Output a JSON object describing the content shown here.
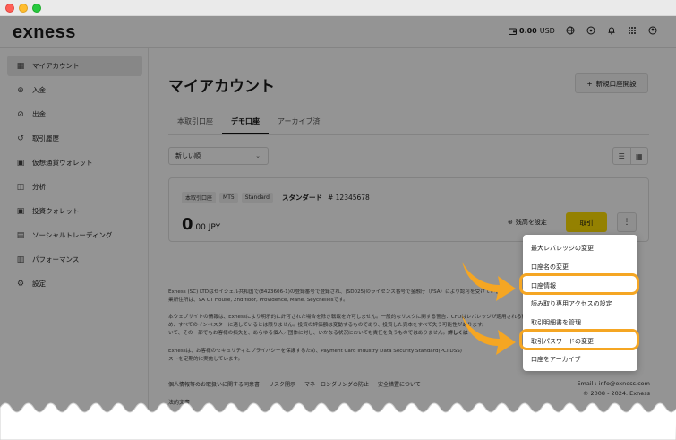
{
  "header": {
    "logo": "exness",
    "balance_amount": "0.00",
    "balance_currency": "USD",
    "icons": [
      "wallet-icon",
      "globe-icon",
      "help-icon",
      "bell-icon",
      "apps-grid-icon",
      "profile-icon"
    ]
  },
  "sidebar": {
    "items": [
      {
        "label": "マイアカウント",
        "icon": "grid-icon"
      },
      {
        "label": "入金",
        "icon": "deposit-icon"
      },
      {
        "label": "出金",
        "icon": "withdraw-icon"
      },
      {
        "label": "取引履歴",
        "icon": "history-icon"
      },
      {
        "label": "仮想通貨ウォレット",
        "icon": "wallet-icon"
      },
      {
        "label": "分析",
        "icon": "analytics-icon"
      },
      {
        "label": "投資ウォレット",
        "icon": "invest-wallet-icon"
      },
      {
        "label": "ソーシャルトレーディング",
        "icon": "social-icon"
      },
      {
        "label": "パフォーマンス",
        "icon": "performance-icon"
      },
      {
        "label": "設定",
        "icon": "settings-icon"
      }
    ]
  },
  "main": {
    "title": "マイアカウント",
    "new_account_label": "新規口座開設",
    "tabs": [
      {
        "label": "本取引口座"
      },
      {
        "label": "デモ口座"
      },
      {
        "label": "アーカイブ済"
      }
    ],
    "sort_select": "新しい順",
    "account": {
      "badges": [
        "本取引口座",
        "MT5",
        "Standard"
      ],
      "name": "スタンダード",
      "number": "# 12345678",
      "balance_int": "0",
      "balance_dec": ".00 JPY",
      "set_balance_label": "残高を設定",
      "trade_label": "取引"
    }
  },
  "dropdown": {
    "items": [
      "最大レバレッジの変更",
      "口座名の変更",
      "口座情報",
      "読み取り専用アクセスの設定",
      "取引明細書を管理",
      "取引パスワードの変更",
      "口座をアーカイブ"
    ]
  },
  "legal": {
    "p1": "Exness (SC) LTDはセイシェル共和国で(8423606-1)の登録番号で登録され、(SD025)のライセンス番号で金融庁（FSA）により認可を受けています。",
    "p1b": "業所住所は、9A CT House, 2nd floor, Providence, Mahe, Seychellesです。",
    "p2": "本ウェブサイトの情報は、Exnessにより明示的に許可された場合を除き転載を許可しません。一般的なリスクに関する警告：CFDはレバレッジが適用される商品のため、",
    "p2b": "め、すべてのインベスターに適しているとは限りません。投資の評価額は変動するものであり、投資した資本をすべて失う可能性があります。",
    "p2c": "いて、その一部でもお客様の損失を、あらゆる個人／団体に対し、いかなる状況においても責任を負うものではありません。",
    "p2_link": "詳しくは",
    "p3": "Exnessは、お客様のセキュリティとプライバシーを保護するため、Payment Card Industry Data Security Standard(PCI DSS)",
    "p3b": "ストを定期的に実施しています。"
  },
  "footer": {
    "links": [
      "個人情報等のお取扱いに関する同意書",
      "リスク開示",
      "マネーロンダリングの防止",
      "安全措置について"
    ],
    "link2": "法的文書",
    "email": "Email : info@exness.com",
    "copyright": "© 2008 - 2024. Exness"
  },
  "colors": {
    "accent_yellow": "#ffde02",
    "highlight_orange": "#f5a623"
  }
}
